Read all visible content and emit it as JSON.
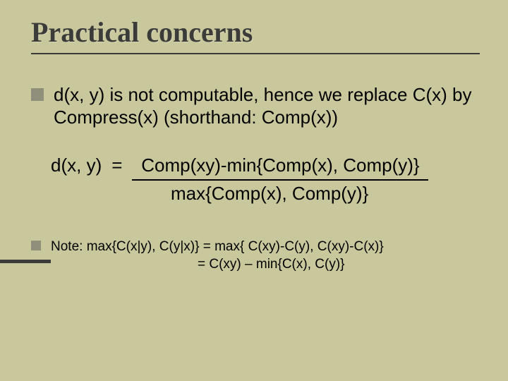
{
  "title": "Practical concerns",
  "bullets": [
    {
      "text": "d(x, y) is not computable, hence we replace C(x) by Compress(x) (shorthand: Comp(x))"
    }
  ],
  "formula": {
    "lhs": "d(x, y)",
    "eq": "=",
    "numerator": "Comp(xy)-min{Comp(x), Comp(y)}",
    "denominator": "max{Comp(x), Comp(y)}"
  },
  "note": {
    "prefix": "Note: max{C(x|y), C(y|x)} = max{ C(xy)-C(y), C(xy)-C(x)}",
    "line2": "= C(xy) – min{C(x), C(y)}"
  }
}
